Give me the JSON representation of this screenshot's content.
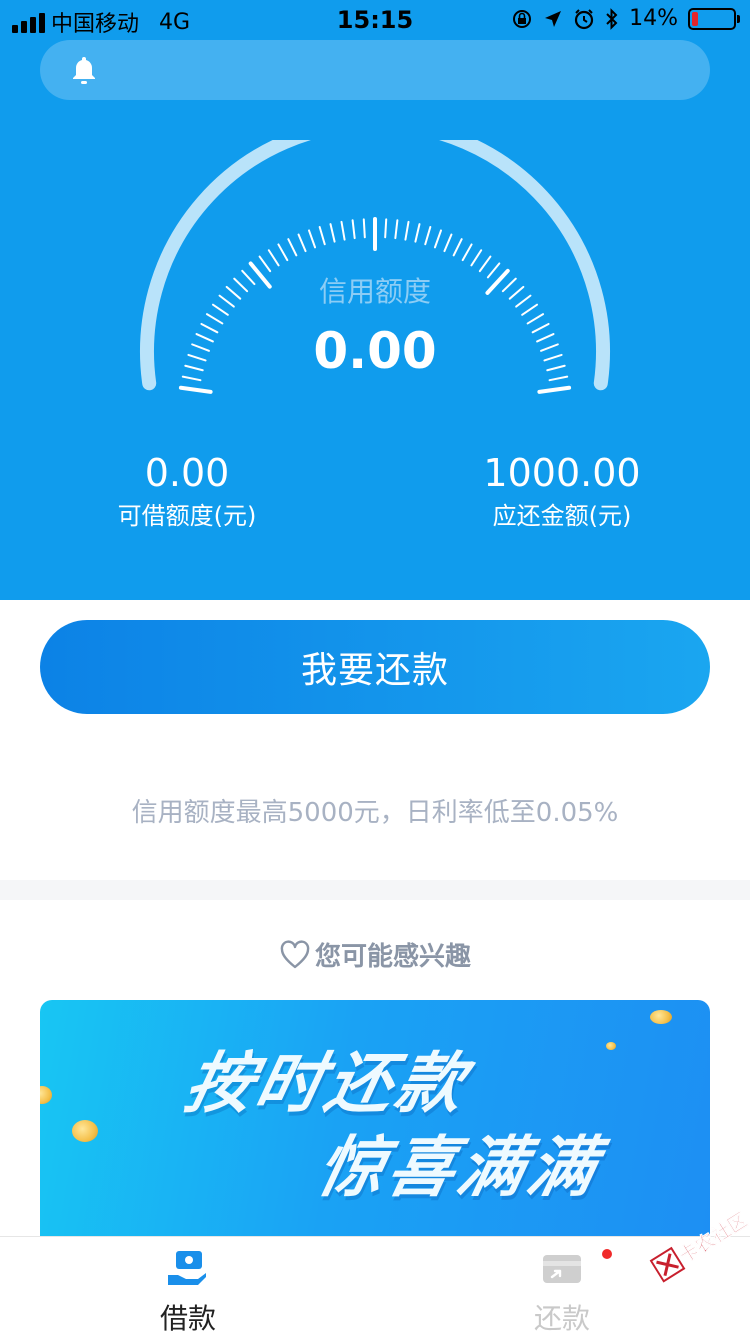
{
  "status_bar": {
    "carrier": "中国移动",
    "network": "4G",
    "time": "15:15",
    "battery_text": "14%",
    "battery_level": 0.14,
    "icons": [
      "orientation-lock-icon",
      "location-arrow-icon",
      "alarm-icon",
      "bluetooth-icon"
    ]
  },
  "notice": {
    "icon": "bell-icon",
    "text": ""
  },
  "gauge": {
    "label": "信用额度",
    "value": "0.00"
  },
  "stats": {
    "available": {
      "value": "0.00",
      "label": "可借额度(元)"
    },
    "due": {
      "value": "1000.00",
      "label": "应还金额(元)"
    }
  },
  "repay_button": {
    "label": "我要还款"
  },
  "promo": {
    "text": "信用额度最高5000元，日利率低至0.05%"
  },
  "interest": {
    "icon": "heart-icon",
    "title": "您可能感兴趣"
  },
  "banner": {
    "line1": "按时还款",
    "line2": "惊喜满满"
  },
  "tabs": [
    {
      "label": "借款",
      "icon": "borrow-icon",
      "active": true
    },
    {
      "label": "还款",
      "icon": "repay-card-icon",
      "active": false,
      "badge": true
    }
  ],
  "watermark": {
    "text": "卡农社区"
  },
  "colors": {
    "primary": "#109ced",
    "button_start": "#0c82e6",
    "button_end": "#1aa6f0",
    "muted_text": "#a8b2c3",
    "badge": "#f02a2a"
  }
}
